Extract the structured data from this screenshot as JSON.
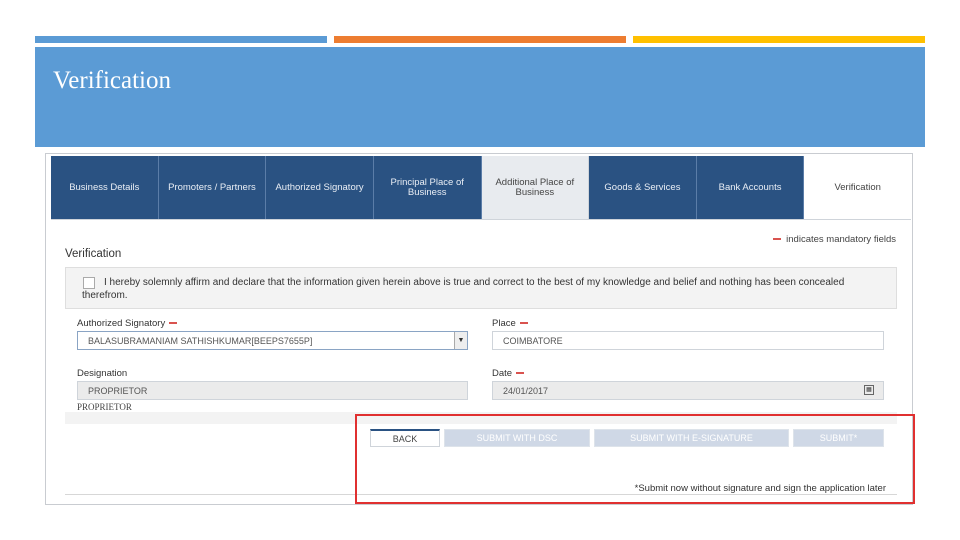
{
  "slide": {
    "title": "Verification",
    "colors": {
      "blue": "#5b9bd5",
      "orange": "#ed7d31",
      "gold": "#ffc000",
      "highlight": "#e03030"
    }
  },
  "form": {
    "tabs": [
      {
        "label": "Business Details"
      },
      {
        "label": "Promoters / Partners"
      },
      {
        "label": "Authorized Signatory"
      },
      {
        "label": "Principal Place of Business"
      },
      {
        "label": "Additional Place of Business"
      },
      {
        "label": "Goods & Services"
      },
      {
        "label": "Bank Accounts"
      },
      {
        "label": "Verification"
      }
    ],
    "mandatory_note": "indicates mandatory fields",
    "section_title": "Verification",
    "declaration": "I hereby solemnly affirm and declare that the information given herein above is true and correct to the best of my knowledge and belief and nothing has been concealed therefrom.",
    "authorized_signatory": {
      "label": "Authorized Signatory",
      "value": "BALASUBRAMANIAM SATHISHKUMAR[BEEPS7655P]"
    },
    "place": {
      "label": "Place",
      "value": "COIMBATORE"
    },
    "designation": {
      "label": "Designation",
      "value": "PROPRIETOR",
      "below": "PROPRIETOR"
    },
    "date": {
      "label": "Date",
      "value": "24/01/2017"
    },
    "buttons": {
      "back": "BACK",
      "submit_dsc": "SUBMIT WITH DSC",
      "submit_esign": "SUBMIT WITH E-SIGNATURE",
      "submit": "SUBMIT*"
    },
    "footnote": "*Submit now without signature and sign the application later"
  }
}
